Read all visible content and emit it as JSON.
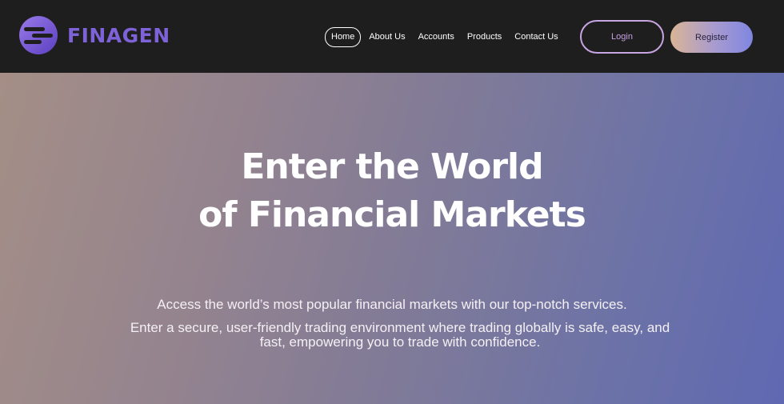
{
  "brand": {
    "name": "FINAGEN",
    "logo_icon": "finagen-logo-icon",
    "color": "#7d62d8"
  },
  "nav": {
    "items": [
      {
        "label": "Home",
        "active": true
      },
      {
        "label": "About Us"
      },
      {
        "label": "Accounts"
      },
      {
        "label": "Products"
      },
      {
        "label": "Contact Us"
      }
    ]
  },
  "auth": {
    "login_label": "Login",
    "register_label": "Register"
  },
  "hero": {
    "title_line1": "Enter the World",
    "title_line2": "of Financial Markets",
    "subtitle_line1": "Access the world’s most popular financial markets with our top-notch services.",
    "subtitle_line2": "Enter a secure, user-friendly trading environment where trading globally is safe, easy, and fast, empowering you to trade with confidence."
  },
  "colors": {
    "header_bg": "#1e1e1f",
    "hero_gradient_start": "#a48e86",
    "hero_gradient_end": "#6068b2",
    "login_border": "#c8a5e2"
  }
}
